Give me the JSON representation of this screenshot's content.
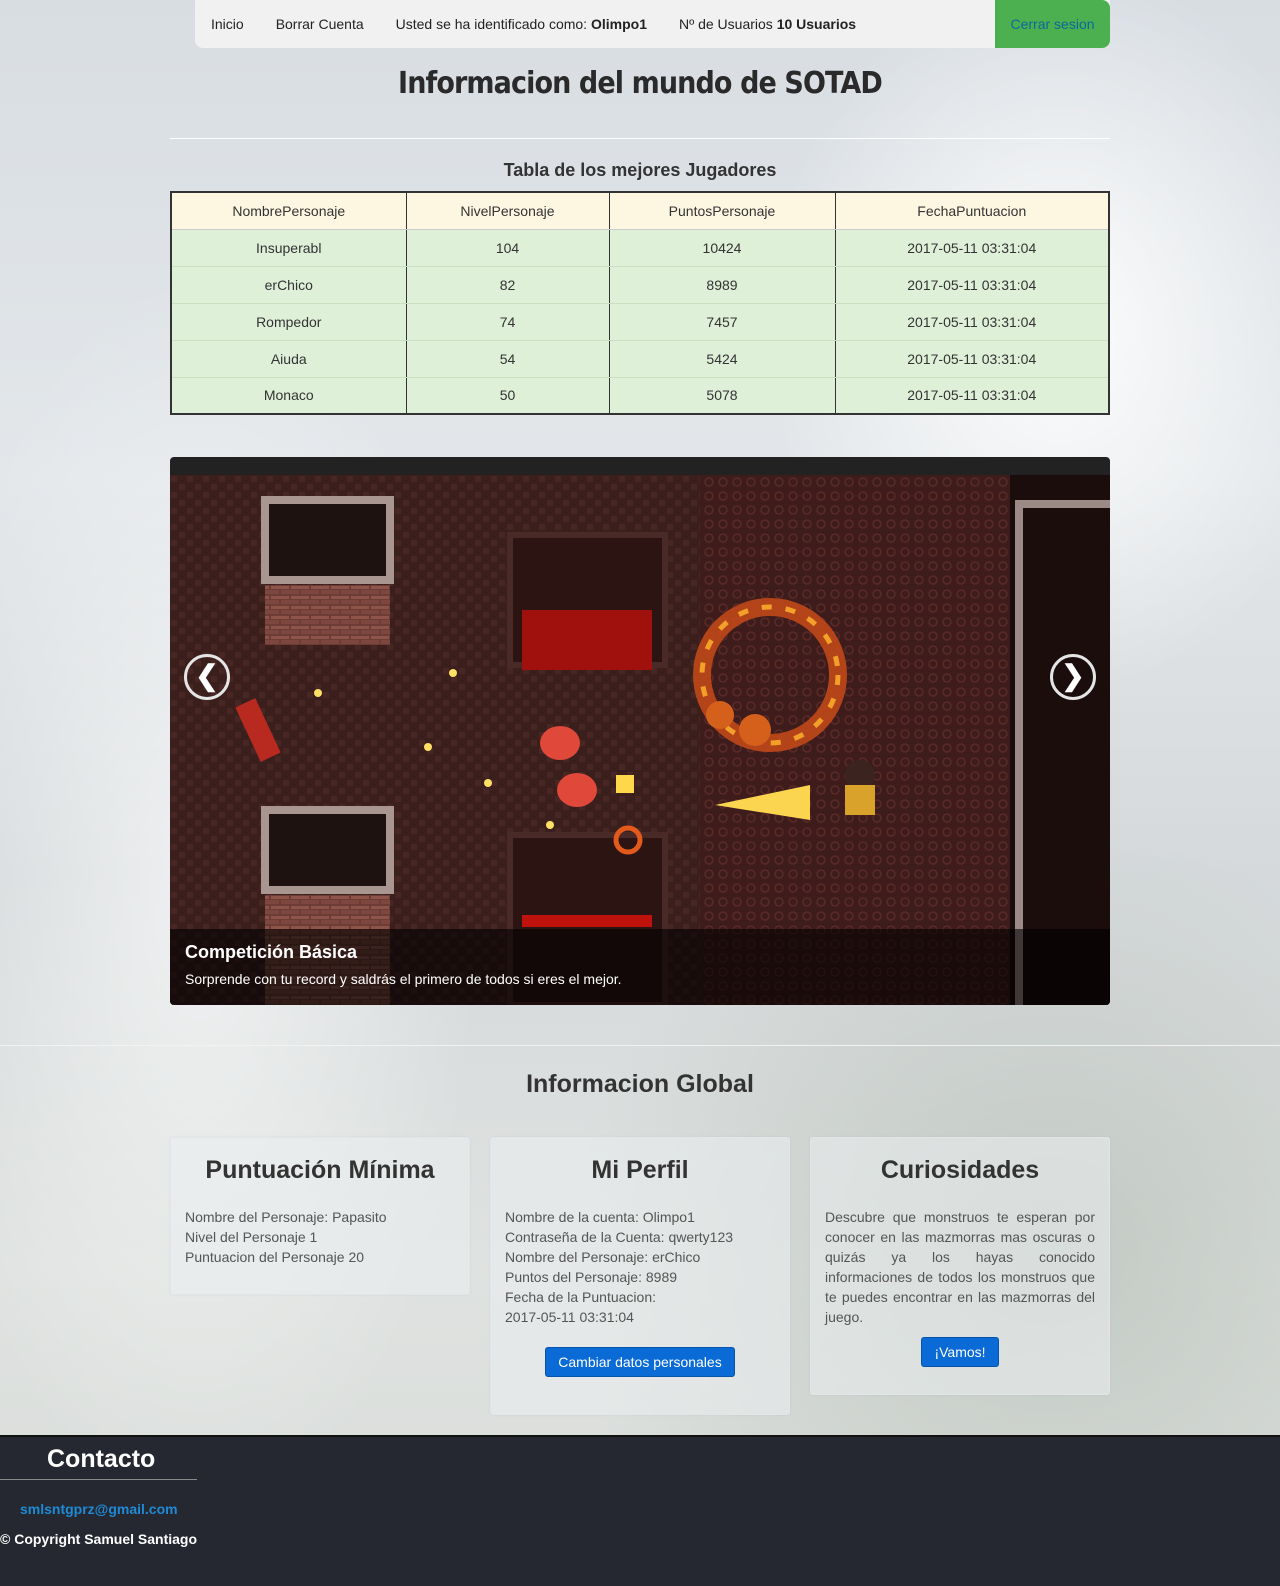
{
  "nav": {
    "inicio": "Inicio",
    "borrar": "Borrar Cuenta",
    "identified_prefix": "Usted se ha identificado como:",
    "identified_user": "Olimpo1",
    "users_prefix": "Nº de Usuarios",
    "users_count": "10 Usuarios",
    "logout": "Cerrar sesion"
  },
  "page_title": "Informacion del mundo de SOTAD",
  "table": {
    "title": "Tabla de los mejores Jugadores",
    "headers": [
      "NombrePersonaje",
      "NivelPersonaje",
      "PuntosPersonaje",
      "FechaPuntuacion"
    ],
    "rows": [
      [
        "Insuperabl",
        "104",
        "10424",
        "2017-05-11 03:31:04"
      ],
      [
        "erChico",
        "82",
        "8989",
        "2017-05-11 03:31:04"
      ],
      [
        "Rompedor",
        "74",
        "7457",
        "2017-05-11 03:31:04"
      ],
      [
        "Aiuda",
        "54",
        "5424",
        "2017-05-11 03:31:04"
      ],
      [
        "Monaco",
        "50",
        "5078",
        "2017-05-11 03:31:04"
      ]
    ]
  },
  "carousel": {
    "prev": "❮",
    "next": "❯",
    "caption_title": "Competición Básica",
    "caption_text": "Sorprende con tu record y saldrás el primero de todos si eres el mejor."
  },
  "global": {
    "title": "Informacion Global",
    "card1": {
      "title": "Puntuación Mínima",
      "lines": [
        "Nombre del Personaje: Papasito",
        "Nivel del Personaje 1",
        "Puntuacion del Personaje 20"
      ]
    },
    "card2": {
      "title": "Mi Perfil",
      "lines": [
        "Nombre de la cuenta: Olimpo1",
        "Contraseña de la Cuenta: qwerty123",
        "Nombre del Personaje: erChico",
        "Puntos del Personaje: 8989",
        "Fecha de la Puntuacion:",
        "2017-05-11 03:31:04"
      ],
      "button": "Cambiar datos personales"
    },
    "card3": {
      "title": "Curiosidades",
      "text": "Descubre que monstruos te esperan por conocer en las mazmorras mas oscuras o quizás ya los hayas conocido informaciones de todos los monstruos que te puedes encontrar en las mazmorras del juego.",
      "button": "¡Vamos!"
    }
  },
  "footer": {
    "title": "Contacto",
    "email": "smlsntgprz@gmail.com",
    "copyright": "© Copyright Samuel Santiago"
  },
  "colors": {
    "logout_bg": "#4caf50",
    "table_header_bg": "#fdf7e1",
    "table_row_bg": "#dff0d8",
    "button_blue": "#0a6ad6",
    "footer_bg": "#252831",
    "email_link": "#1f8ad6"
  }
}
